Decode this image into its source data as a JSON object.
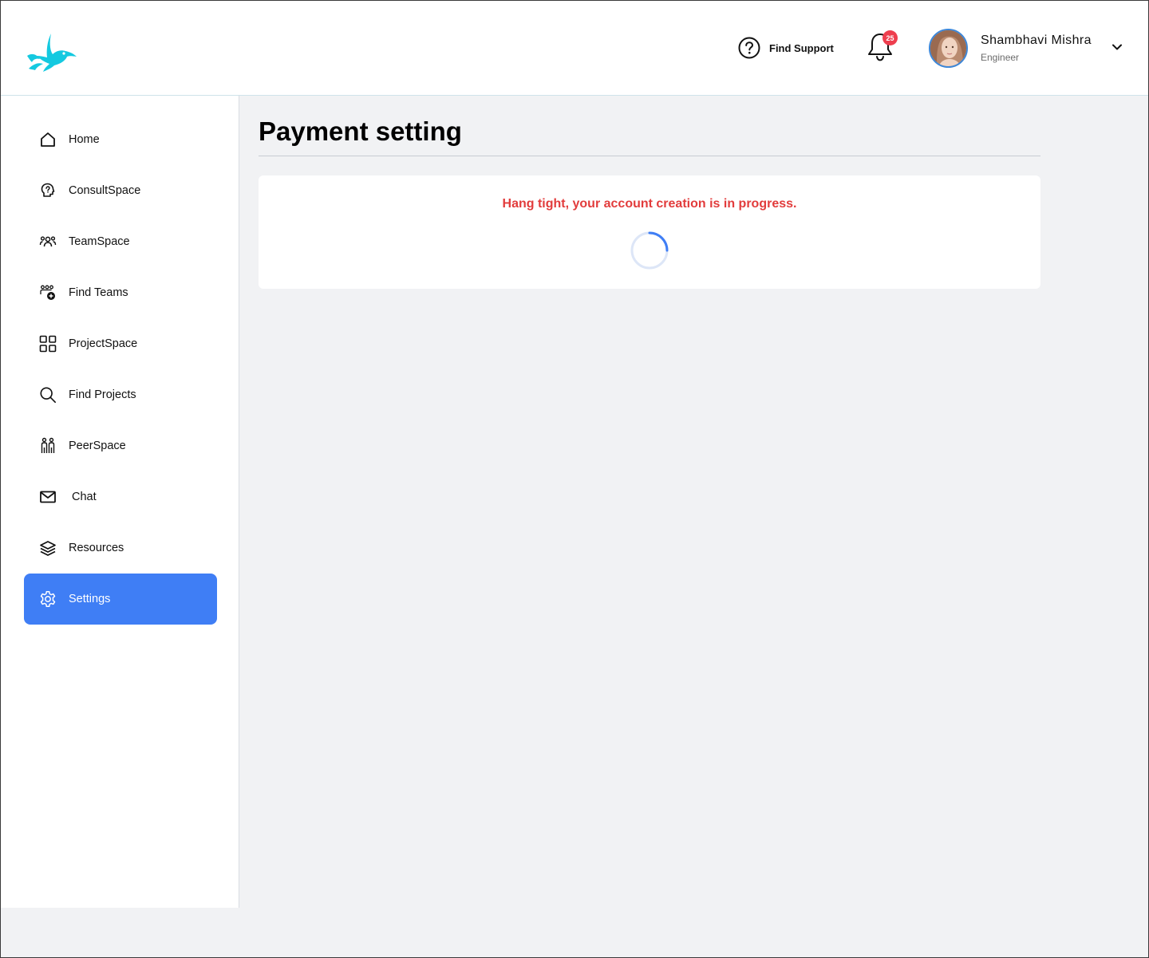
{
  "header": {
    "logo_icon": "hummingbird-logo-icon",
    "support": {
      "icon": "question-circle-icon",
      "label": "Find Support"
    },
    "notifications": {
      "icon": "bell-icon",
      "count": "25"
    },
    "user": {
      "name": "Shambhavi Mishra",
      "role": "Engineer",
      "menu_icon": "chevron-down-icon"
    }
  },
  "sidebar": {
    "items": [
      {
        "label": "Home",
        "icon": "home-icon"
      },
      {
        "label": "ConsultSpace",
        "icon": "lightbulb-icon"
      },
      {
        "label": "TeamSpace",
        "icon": "team-icon"
      },
      {
        "label": "Find Teams",
        "icon": "find-team-icon"
      },
      {
        "label": "ProjectSpace",
        "icon": "grid-icon"
      },
      {
        "label": "Find Projects",
        "icon": "search-icon"
      },
      {
        "label": "PeerSpace",
        "icon": "peers-icon"
      },
      {
        "label": "Chat",
        "icon": "mail-icon"
      },
      {
        "label": "Resources",
        "icon": "layers-icon"
      },
      {
        "label": "Settings",
        "icon": "gear-icon",
        "active": true
      }
    ]
  },
  "main": {
    "title": "Payment setting",
    "status_message": "Hang tight, your account creation is in progress.",
    "loading": true
  },
  "colors": {
    "accent": "#3f7ef5",
    "brand": "#14c9e0",
    "error_text": "#e23c3c",
    "badge": "#ee3e4e",
    "background": "#f1f2f4"
  }
}
